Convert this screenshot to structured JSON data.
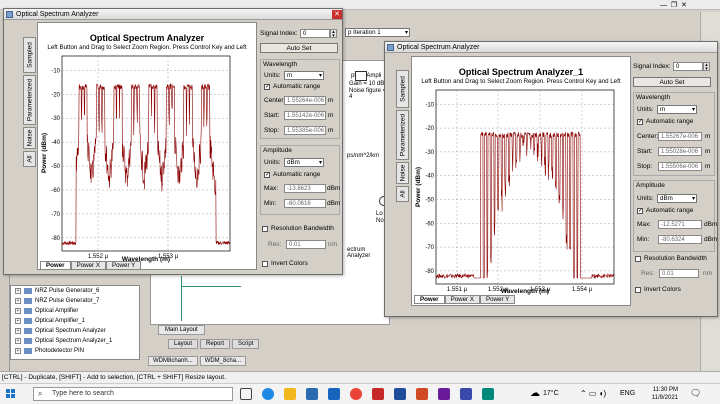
{
  "background": {
    "iteration_dropdown": "p Iteration 1",
    "tree_items": [
      "NRZ Pulse Generator_6",
      "NRZ Pulse Generator_7",
      "Optical Amplifier",
      "Optical Amplifier_1",
      "Optical Spectrum Analyzer",
      "Optical Spectrum Analyzer_1",
      "Photodetector PIN"
    ],
    "layout_texts": {
      "amp": "ptical Ampli",
      "gain": "Gain = 10  dB",
      "noise": "Noise figure = 4",
      "disp": "ps/nm^2/km",
      "lo": "Lo",
      "no": "No",
      "osa_label": "ectrum Analyzer"
    },
    "tabs_bottom": [
      "Main Layout"
    ],
    "view_tabs": [
      "Layout",
      "Report",
      "Script"
    ],
    "doc_tabs": [
      "WDM8chanh...",
      "WDM_8cha..."
    ],
    "status_text": "[CTRL] - Duplicate, [SHIFT] - Add to selection, [CTRL + SHIFT] Resize layout."
  },
  "taskbar": {
    "search_placeholder": "Type here to search",
    "weather": "17°C",
    "lang": "ENG",
    "time": "11:30 PM",
    "date": "11/9/2021"
  },
  "windows": [
    {
      "title": "Optical Spectrum Analyzer",
      "plot_title": "Optical Spectrum Analyzer",
      "plot_subtitle": "Left Button and Drag to Select Zoom Region. Press Control Key and Left",
      "side_tabs": [
        "Sampled",
        "Parameterized",
        "Noise",
        "All"
      ],
      "bottom_tabs": [
        "Power",
        "Power X",
        "Power Y"
      ],
      "ylabel": "Power (dBm)",
      "xlabel": "Wavelength (m)",
      "yticks": [
        "-10",
        "-20",
        "-30",
        "-40",
        "-50",
        "-60",
        "-70",
        "-80"
      ],
      "xticks": [
        "1.552 μ",
        "1.553 μ"
      ],
      "signal_index_label": "Signal Index:",
      "signal_index": "0",
      "autoset": "Auto Set",
      "wavelength_label": "Wavelength",
      "units_label": "Units:",
      "wl_units": "m",
      "auto_range": "Automatic range",
      "center_label": "Center:",
      "center": "1.55264e-006",
      "start_label": "Start:",
      "start": "1.55142e-006",
      "stop_label": "Stop:",
      "stop": "1.55385e-006",
      "wl_unit": "m",
      "amplitude_label": "Amplitude",
      "amp_units": "dBm",
      "max_label": "Max:",
      "max": "-13.8623",
      "min_label": "Min:",
      "min": "-80.0616",
      "amp_unit": "dBm",
      "res_bw": "Resolution Bandwidth",
      "res_label": "Res:",
      "res": "0.01",
      "res_unit": "nm",
      "invert": "Invert Colors"
    },
    {
      "title": "Optical Spectrum Analyzer",
      "plot_title": "Optical Spectrum Analyzer_1",
      "plot_subtitle": "Left Button and Drag to Select Zoom Region. Press Control Key and Left",
      "side_tabs": [
        "Sampled",
        "Parameterized",
        "Noise",
        "All"
      ],
      "bottom_tabs": [
        "Power",
        "Power X",
        "Power Y"
      ],
      "ylabel": "Power (dBm)",
      "xlabel": "Wavelength (m)",
      "yticks": [
        "-10",
        "-20",
        "-30",
        "-40",
        "-50",
        "-60",
        "-70",
        "-80"
      ],
      "xticks": [
        "1.551 μ",
        "1.552 μ",
        "1.553 μ",
        "1.554 μ"
      ],
      "signal_index_label": "Signal Index:",
      "signal_index": "0",
      "autoset": "Auto Set",
      "wavelength_label": "Wavelength",
      "units_label": "Units:",
      "wl_units": "m",
      "auto_range": "Automatic range",
      "center_label": "Center:",
      "center": "1.55267e-006",
      "start_label": "Start:",
      "start": "1.55028e-006",
      "stop_label": "Stop:",
      "stop": "1.55506e-006",
      "wl_unit": "m",
      "amplitude_label": "Amplitude",
      "amp_units": "dBm",
      "max_label": "Max:",
      "max": "-12.5271",
      "min_label": "Min:",
      "min": "-80.6324",
      "amp_unit": "dBm",
      "res_bw": "Resolution Bandwidth",
      "res_label": "Res:",
      "res": "0.01",
      "res_unit": "nm",
      "invert": "Invert Colors"
    }
  ],
  "colors": {
    "trace": "#8b0000",
    "accent": "#3a6ea5"
  }
}
